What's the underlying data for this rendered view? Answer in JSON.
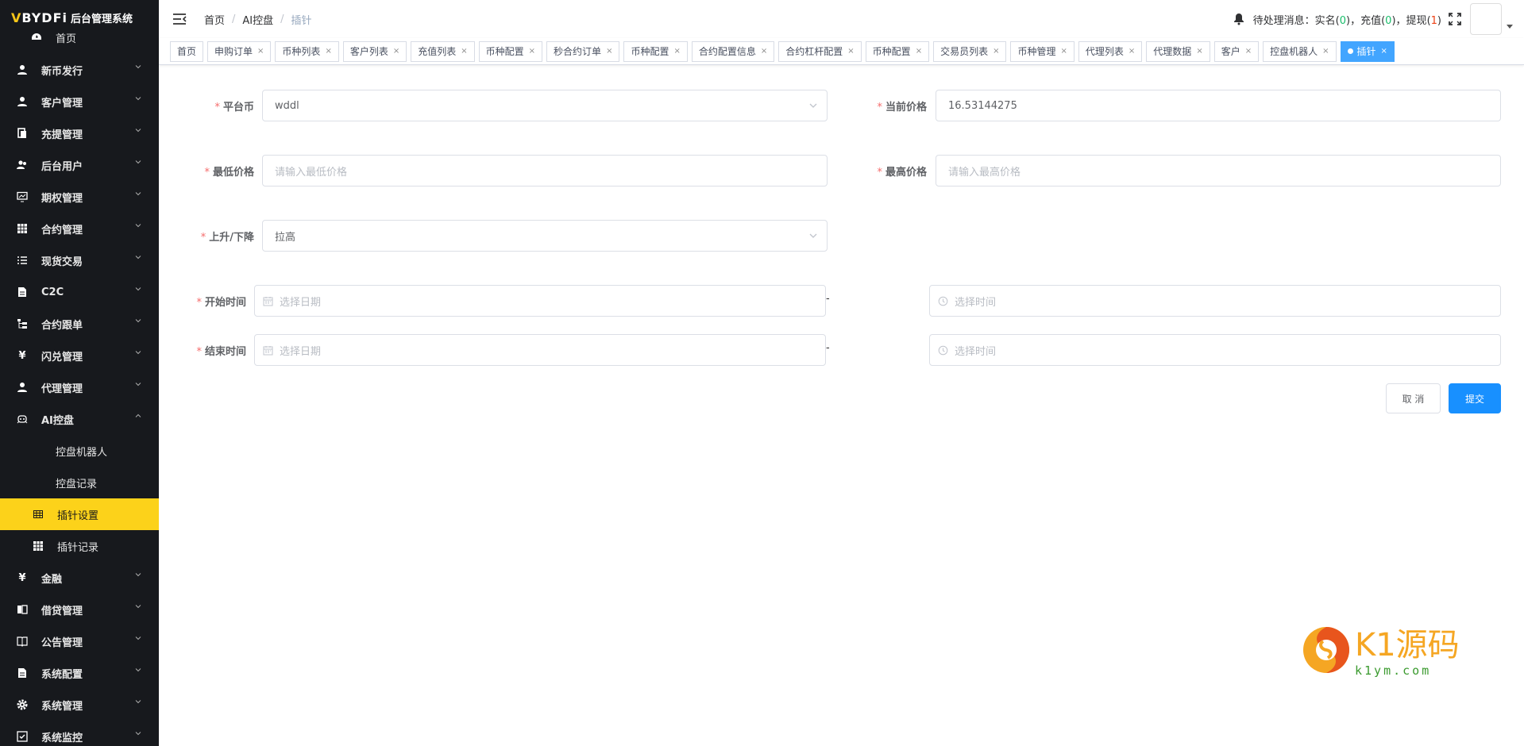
{
  "app": {
    "logo_text": "BYDFi",
    "system_name": "后台管理系统"
  },
  "sidebar": {
    "items": [
      {
        "label": "首页",
        "icon": "dashboard-icon"
      },
      {
        "label": "新币发行",
        "icon": "user-icon"
      },
      {
        "label": "客户管理",
        "icon": "user-icon"
      },
      {
        "label": "充提管理",
        "icon": "clipboard-icon"
      },
      {
        "label": "后台用户",
        "icon": "peoples-icon"
      },
      {
        "label": "期权管理",
        "icon": "monitor-icon"
      },
      {
        "label": "合约管理",
        "icon": "table-icon"
      },
      {
        "label": "现货交易",
        "icon": "list-icon"
      },
      {
        "label": "C2C",
        "icon": "document-icon"
      },
      {
        "label": "合约跟单",
        "icon": "tree-icon"
      },
      {
        "label": "闪兑管理",
        "icon": "yen-icon"
      },
      {
        "label": "代理管理",
        "icon": "user-icon"
      },
      {
        "label": "AI控盘",
        "icon": "robot-icon"
      },
      {
        "label": "控盘机器人",
        "icon": ""
      },
      {
        "label": "控盘记录",
        "icon": ""
      },
      {
        "label": "插针设置",
        "icon": "grid-icon"
      },
      {
        "label": "插针记录",
        "icon": "table-icon"
      },
      {
        "label": "金融",
        "icon": "yen-icon"
      },
      {
        "label": "借贷管理",
        "icon": "book-icon"
      },
      {
        "label": "公告管理",
        "icon": "book-open-icon"
      },
      {
        "label": "系统配置",
        "icon": "document-icon"
      },
      {
        "label": "系统管理",
        "icon": "gear-icon"
      },
      {
        "label": "系统监控",
        "icon": "monitor-check-icon"
      }
    ]
  },
  "header": {
    "breadcrumb": [
      "首页",
      "AI控盘",
      "插针"
    ],
    "pending_label": "待处理消息：",
    "realname_label": "实名",
    "realname_count": "0",
    "recharge_label": "充值",
    "recharge_count": "0",
    "withdraw_label": "提现",
    "withdraw_count": "1"
  },
  "tags": [
    "首页",
    "申购订单",
    "币种列表",
    "客户列表",
    "充值列表",
    "币种配置",
    "秒合约订单",
    "币种配置",
    "合约配置信息",
    "合约杠杆配置",
    "币种配置",
    "交易员列表",
    "币种管理",
    "代理列表",
    "代理数据",
    "客户",
    "控盘机器人",
    "插针"
  ],
  "form": {
    "platform_coin": {
      "label": "平台币",
      "value": "wddl"
    },
    "current_price": {
      "label": "当前价格",
      "value": "16.53144275"
    },
    "min_price": {
      "label": "最低价格",
      "placeholder": "请输入最低价格"
    },
    "max_price": {
      "label": "最高价格",
      "placeholder": "请输入最高价格"
    },
    "direction": {
      "label": "上升/下降",
      "value": "拉高"
    },
    "start_time": {
      "label": "开始时间",
      "date_placeholder": "选择日期",
      "time_placeholder": "选择时间"
    },
    "end_time": {
      "label": "结束时间",
      "date_placeholder": "选择日期",
      "time_placeholder": "选择时间"
    },
    "range_sep": "-",
    "cancel_label": "取 消",
    "submit_label": "提交"
  },
  "watermark": {
    "brand": "K1源码",
    "url": "k1ym.com"
  },
  "colors": {
    "sidebar_bg": "#17191d",
    "active_menu": "#fcd21a",
    "primary": "#1890ff",
    "active_tag": "#42a5ff",
    "required": "#f56c6c"
  }
}
